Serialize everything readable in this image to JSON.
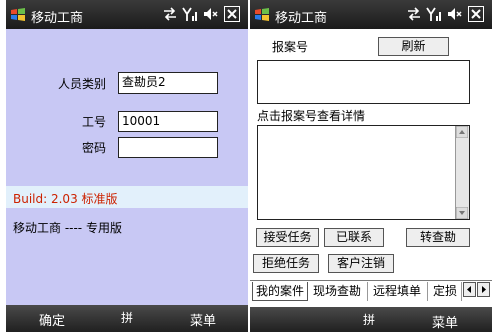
{
  "left": {
    "title": "移动工商",
    "fields": {
      "role_label": "人员类别",
      "role_value": "查勘员2",
      "id_label": "工号",
      "id_value": "10001",
      "password_label": "密码",
      "password_value": ""
    },
    "build_text": "Build: 2.03 标准版",
    "footer_text": "移动工商 ---- 专用版",
    "softkeys": {
      "left": "确定",
      "center": "拼",
      "right": "菜单"
    }
  },
  "right": {
    "title": "移动工商",
    "case_label": "报案号",
    "refresh_button": "刷新",
    "case_value": "",
    "detail_hint": "点击报案号查看详情",
    "detail_value": "",
    "buttons": {
      "accept": "接受任务",
      "contacted": "已联系",
      "transfer": "转查勘",
      "reject": "拒绝任务",
      "logout": "客户注销"
    },
    "tabs": [
      "我的案件",
      "现场查勘",
      "远程填单",
      "定损"
    ],
    "softkeys": {
      "center": "拼",
      "right": "菜单"
    }
  },
  "colors": {
    "left_bg": "#c8c8f4",
    "build_text": "#cc2200",
    "band": "#e2f0fb"
  }
}
